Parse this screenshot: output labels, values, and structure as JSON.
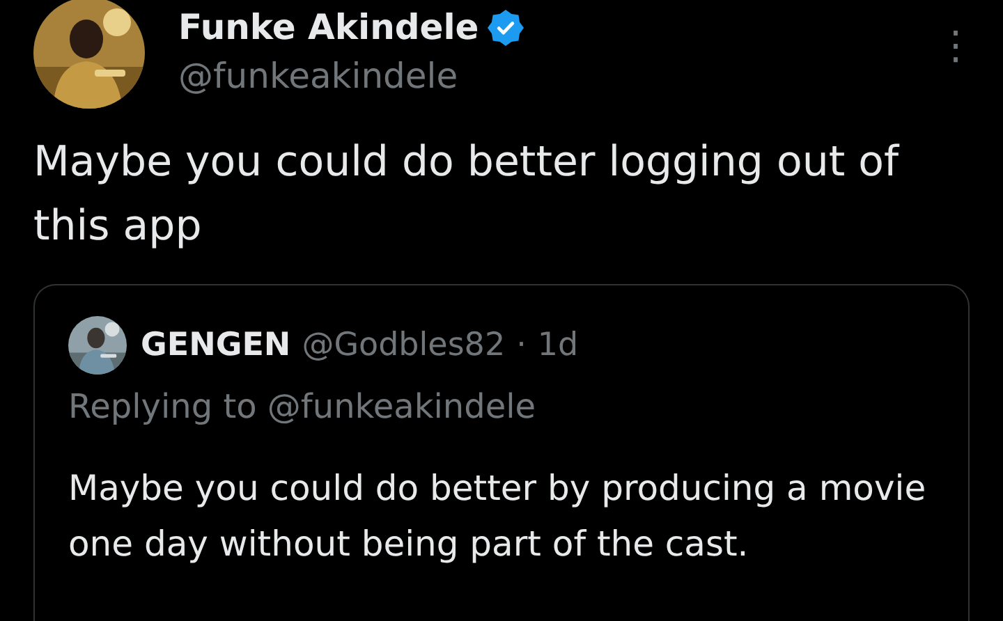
{
  "tweet": {
    "author": {
      "name": "Funke Akindele",
      "verified": true,
      "handle": "@funkeakindele"
    },
    "menu_icon": "⋮",
    "text": "Maybe you could do better logging out of this app",
    "quoted_tweet": {
      "author": {
        "name": "GENGEN",
        "handle": "@Godbles82"
      },
      "separator": "·",
      "time": "1d",
      "replying_to": "Replying to @funkeakindele",
      "text": "Maybe you could do better by producing a movie one day without being part of the cast."
    }
  }
}
